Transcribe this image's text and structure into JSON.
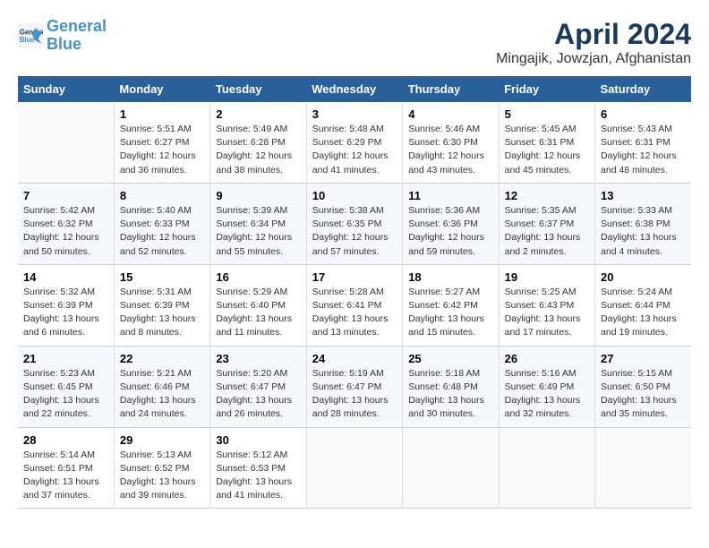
{
  "header": {
    "logo_line1": "General",
    "logo_line2": "Blue",
    "month_title": "April 2024",
    "location": "Mingajik, Jowzjan, Afghanistan"
  },
  "weekdays": [
    "Sunday",
    "Monday",
    "Tuesday",
    "Wednesday",
    "Thursday",
    "Friday",
    "Saturday"
  ],
  "weeks": [
    [
      {
        "day": "",
        "info": ""
      },
      {
        "day": "1",
        "info": "Sunrise: 5:51 AM\nSunset: 6:27 PM\nDaylight: 12 hours\nand 36 minutes."
      },
      {
        "day": "2",
        "info": "Sunrise: 5:49 AM\nSunset: 6:28 PM\nDaylight: 12 hours\nand 38 minutes."
      },
      {
        "day": "3",
        "info": "Sunrise: 5:48 AM\nSunset: 6:29 PM\nDaylight: 12 hours\nand 41 minutes."
      },
      {
        "day": "4",
        "info": "Sunrise: 5:46 AM\nSunset: 6:30 PM\nDaylight: 12 hours\nand 43 minutes."
      },
      {
        "day": "5",
        "info": "Sunrise: 5:45 AM\nSunset: 6:31 PM\nDaylight: 12 hours\nand 45 minutes."
      },
      {
        "day": "6",
        "info": "Sunrise: 5:43 AM\nSunset: 6:31 PM\nDaylight: 12 hours\nand 48 minutes."
      }
    ],
    [
      {
        "day": "7",
        "info": "Sunrise: 5:42 AM\nSunset: 6:32 PM\nDaylight: 12 hours\nand 50 minutes."
      },
      {
        "day": "8",
        "info": "Sunrise: 5:40 AM\nSunset: 6:33 PM\nDaylight: 12 hours\nand 52 minutes."
      },
      {
        "day": "9",
        "info": "Sunrise: 5:39 AM\nSunset: 6:34 PM\nDaylight: 12 hours\nand 55 minutes."
      },
      {
        "day": "10",
        "info": "Sunrise: 5:38 AM\nSunset: 6:35 PM\nDaylight: 12 hours\nand 57 minutes."
      },
      {
        "day": "11",
        "info": "Sunrise: 5:36 AM\nSunset: 6:36 PM\nDaylight: 12 hours\nand 59 minutes."
      },
      {
        "day": "12",
        "info": "Sunrise: 5:35 AM\nSunset: 6:37 PM\nDaylight: 13 hours\nand 2 minutes."
      },
      {
        "day": "13",
        "info": "Sunrise: 5:33 AM\nSunset: 6:38 PM\nDaylight: 13 hours\nand 4 minutes."
      }
    ],
    [
      {
        "day": "14",
        "info": "Sunrise: 5:32 AM\nSunset: 6:39 PM\nDaylight: 13 hours\nand 6 minutes."
      },
      {
        "day": "15",
        "info": "Sunrise: 5:31 AM\nSunset: 6:39 PM\nDaylight: 13 hours\nand 8 minutes."
      },
      {
        "day": "16",
        "info": "Sunrise: 5:29 AM\nSunset: 6:40 PM\nDaylight: 13 hours\nand 11 minutes."
      },
      {
        "day": "17",
        "info": "Sunrise: 5:28 AM\nSunset: 6:41 PM\nDaylight: 13 hours\nand 13 minutes."
      },
      {
        "day": "18",
        "info": "Sunrise: 5:27 AM\nSunset: 6:42 PM\nDaylight: 13 hours\nand 15 minutes."
      },
      {
        "day": "19",
        "info": "Sunrise: 5:25 AM\nSunset: 6:43 PM\nDaylight: 13 hours\nand 17 minutes."
      },
      {
        "day": "20",
        "info": "Sunrise: 5:24 AM\nSunset: 6:44 PM\nDaylight: 13 hours\nand 19 minutes."
      }
    ],
    [
      {
        "day": "21",
        "info": "Sunrise: 5:23 AM\nSunset: 6:45 PM\nDaylight: 13 hours\nand 22 minutes."
      },
      {
        "day": "22",
        "info": "Sunrise: 5:21 AM\nSunset: 6:46 PM\nDaylight: 13 hours\nand 24 minutes."
      },
      {
        "day": "23",
        "info": "Sunrise: 5:20 AM\nSunset: 6:47 PM\nDaylight: 13 hours\nand 26 minutes."
      },
      {
        "day": "24",
        "info": "Sunrise: 5:19 AM\nSunset: 6:47 PM\nDaylight: 13 hours\nand 28 minutes."
      },
      {
        "day": "25",
        "info": "Sunrise: 5:18 AM\nSunset: 6:48 PM\nDaylight: 13 hours\nand 30 minutes."
      },
      {
        "day": "26",
        "info": "Sunrise: 5:16 AM\nSunset: 6:49 PM\nDaylight: 13 hours\nand 32 minutes."
      },
      {
        "day": "27",
        "info": "Sunrise: 5:15 AM\nSunset: 6:50 PM\nDaylight: 13 hours\nand 35 minutes."
      }
    ],
    [
      {
        "day": "28",
        "info": "Sunrise: 5:14 AM\nSunset: 6:51 PM\nDaylight: 13 hours\nand 37 minutes."
      },
      {
        "day": "29",
        "info": "Sunrise: 5:13 AM\nSunset: 6:52 PM\nDaylight: 13 hours\nand 39 minutes."
      },
      {
        "day": "30",
        "info": "Sunrise: 5:12 AM\nSunset: 6:53 PM\nDaylight: 13 hours\nand 41 minutes."
      },
      {
        "day": "",
        "info": ""
      },
      {
        "day": "",
        "info": ""
      },
      {
        "day": "",
        "info": ""
      },
      {
        "day": "",
        "info": ""
      }
    ]
  ]
}
